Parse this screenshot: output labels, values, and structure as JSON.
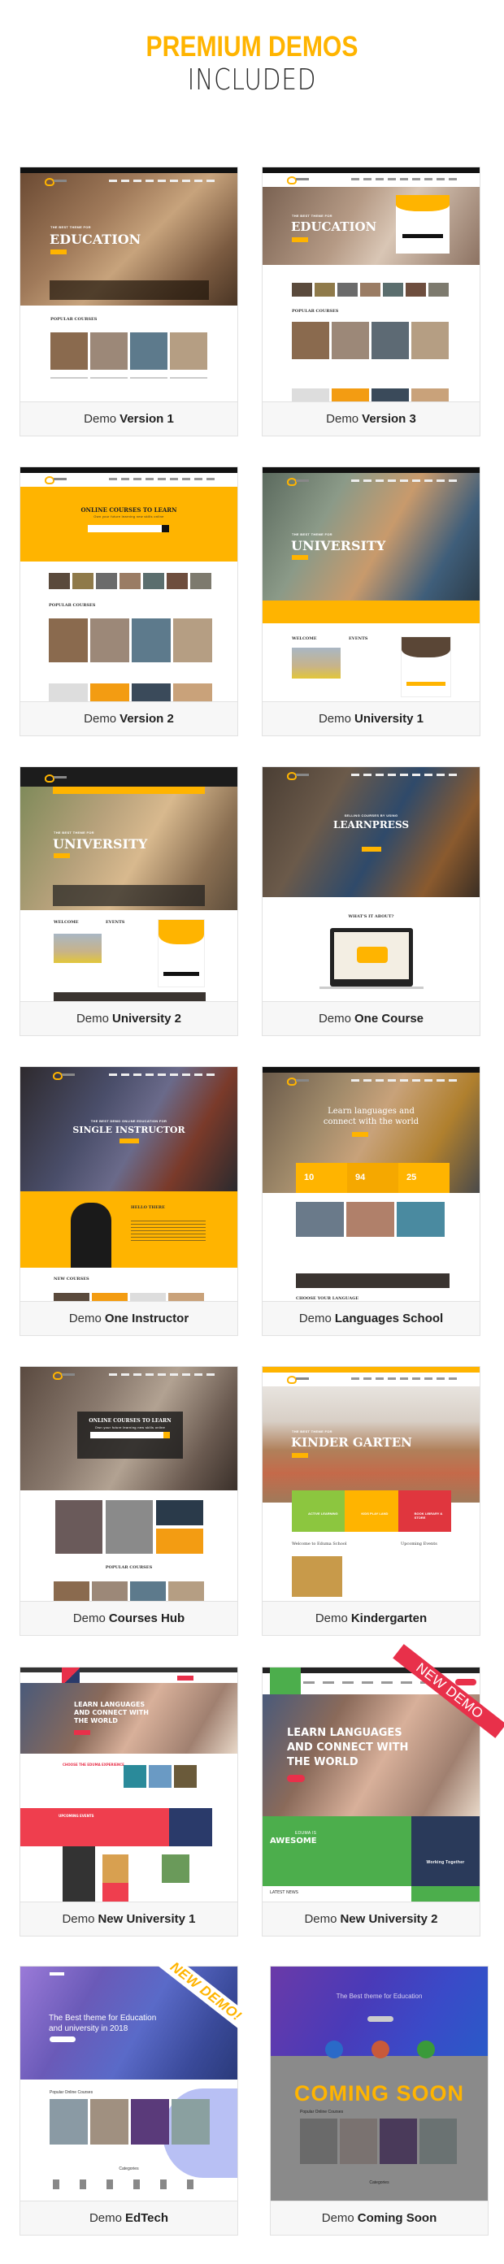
{
  "header": {
    "title": "PREMIUM DEMOS",
    "subtitle": "INCLUDED"
  },
  "colors": {
    "accent": "#ffb400",
    "label_bg": "#f7f7f7",
    "border": "#e2e2e2",
    "red": "#e8304a",
    "green": "#4caf50"
  },
  "label_prefix": "Demo",
  "demos": [
    {
      "name": "Version 1",
      "hero_kicker": "THE BEST THEME FOR",
      "hero_title": "EDUCATION",
      "section": "POPULAR COURSES"
    },
    {
      "name": "Version 3",
      "hero_kicker": "THE BEST THEME FOR",
      "hero_title": "EDUCATION",
      "section": "POPULAR COURSES"
    },
    {
      "name": "Version 2",
      "hero_title": "ONLINE COURSES TO LEARN",
      "hero_sub": "Own your future learning new skills online",
      "section": "POPULAR COURSES"
    },
    {
      "name": "University 1",
      "hero_kicker": "THE BEST THEME FOR",
      "hero_title": "UNIVERSITY",
      "section": "WELCOME",
      "section2": "EVENTS"
    },
    {
      "name": "University 2",
      "hero_kicker": "THE BEST THEME FOR",
      "hero_title": "UNIVERSITY",
      "section": "WELCOME",
      "section2": "EVENTS"
    },
    {
      "name": "One Course",
      "hero_kicker": "SELLING COURSES BY USING",
      "hero_title": "LEARNPRESS",
      "section": "WHAT'S IT ABOUT?"
    },
    {
      "name": "One Instructor",
      "hero_kicker": "THE BEST DEMO ONLINE EDUCATION FOR",
      "hero_title": "SINGLE INSTRUCTOR",
      "section": "HELLO THERE",
      "section2": "NEW COURSES"
    },
    {
      "name": "Languages School",
      "hero_title": "Learn languages and",
      "hero_title2": "connect with the world",
      "stats": [
        "10",
        "94",
        "25"
      ],
      "section": "CHOOSE YOUR LANGUAGE"
    },
    {
      "name": "Courses Hub",
      "hero_title": "ONLINE COURSES TO LEARN",
      "hero_sub": "Own your future learning new skills online",
      "section": "POPULAR COURSES"
    },
    {
      "name": "Kindergarten",
      "hero_kicker": "THE BEST THEME FOR",
      "hero_title": "KINDER GARTEN",
      "boxes": [
        "ACTIVE LEARNING",
        "KIDS PLAY LAND",
        "BOOK LIBRARY & STORE"
      ],
      "section": "Welcome to Eduma School",
      "section2": "Upcoming Events"
    },
    {
      "name": "New University 1",
      "hero_title": "LEARN LANGUAGES",
      "hero_title2": "AND CONNECT WITH",
      "hero_title3": "THE WORLD",
      "section": "CHOOSE THE EDUMA EXPERIENCE",
      "section2": "UPCOMING EVENTS"
    },
    {
      "name": "New University 2",
      "hero_title": "LEARN LANGUAGES",
      "hero_title2": "AND CONNECT WITH",
      "hero_title3": "THE WORLD",
      "section": "AWESOME",
      "section_kicker": "EDUMA IS",
      "section2": "LATEST NEWS",
      "section3": "Working Together",
      "ribbon": "NEW DEMO"
    },
    {
      "name": "EdTech",
      "hero_title": "The Best theme for Education",
      "hero_title2": "and university in 2018",
      "section": "Popular Online Courses",
      "section2": "Categories",
      "ribbon": "NEW DEMO!"
    },
    {
      "name": "Coming Soon",
      "hero_title": "The Best theme for Education",
      "section": "Popular Online Courses",
      "section2": "Categories",
      "overlay": "COMING SOON"
    }
  ]
}
